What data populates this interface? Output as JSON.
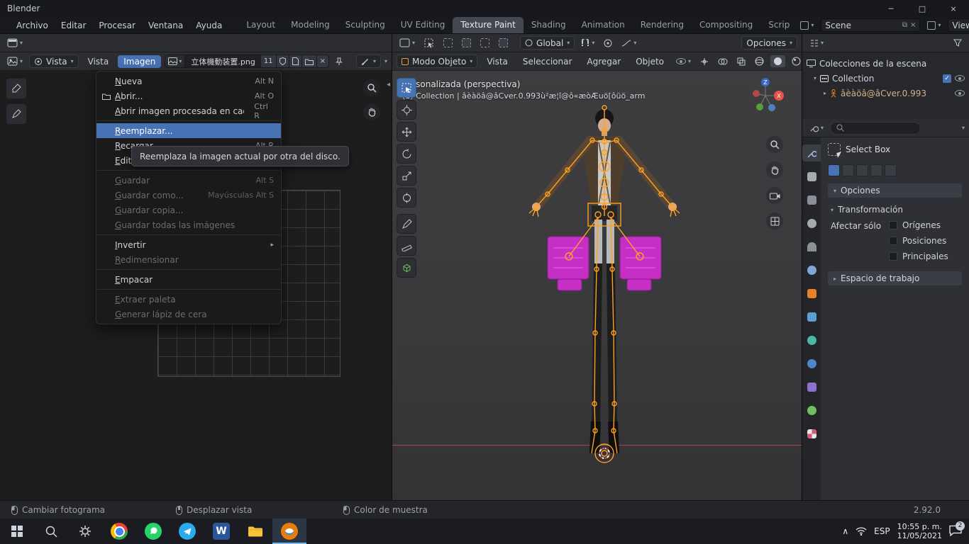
{
  "icons": {
    "chevron_down": "▾",
    "chevron_right": "▸",
    "chevron_left": "◂",
    "tray_chevron": "∧",
    "close": "×",
    "minimize": "─",
    "maximize": "□",
    "check": "✓"
  },
  "colors": {
    "accent_blue": "#4772b3",
    "blender_orange": "#e87d0d",
    "armature_orange": "#ffa021",
    "gear_magenta": "#c62fc6"
  },
  "titlebar": {
    "title": "Blender"
  },
  "topbar": {
    "menus": [
      {
        "label": "Archivo"
      },
      {
        "label": "Editar"
      },
      {
        "label": "Procesar"
      },
      {
        "label": "Ventana"
      },
      {
        "label": "Ayuda"
      }
    ],
    "workspaces": [
      {
        "label": "Layout"
      },
      {
        "label": "Modeling"
      },
      {
        "label": "Sculpting"
      },
      {
        "label": "UV Editing"
      },
      {
        "label": "Texture Paint"
      },
      {
        "label": "Shading"
      },
      {
        "label": "Animation"
      },
      {
        "label": "Rendering"
      },
      {
        "label": "Compositing"
      },
      {
        "label": "Scrip"
      }
    ],
    "scene": {
      "value": "Scene"
    },
    "view_layer": {
      "value": "View Layer"
    }
  },
  "image_editor": {
    "mode": "Vista",
    "view_menu": "Vista",
    "image_menu": "Imagen",
    "image": {
      "name": "立体機動装置.png",
      "users": "11"
    },
    "menu": {
      "items": [
        {
          "label": "Nueva",
          "shortcut": "Alt N"
        },
        {
          "label": "Abrir...",
          "shortcut": "Alt O"
        },
        {
          "label": "Abrir imagen procesada en caché",
          "shortcut": "Ctrl R"
        },
        {
          "label": "Reemplazar...",
          "shortcut": ""
        },
        {
          "label": "Recargar",
          "shortcut": "Alt R"
        },
        {
          "label": "Editar e",
          "shortcut": ""
        },
        {
          "label": "Guardar",
          "shortcut": "Alt S"
        },
        {
          "label": "Guardar como...",
          "shortcut": "Mayúsculas Alt S"
        },
        {
          "label": "Guardar copia...",
          "shortcut": ""
        },
        {
          "label": "Guardar todas las imágenes",
          "shortcut": ""
        },
        {
          "label": "Invertir",
          "shortcut": ""
        },
        {
          "label": "Redimensionar",
          "shortcut": ""
        },
        {
          "label": "Empacar",
          "shortcut": ""
        },
        {
          "label": "Extraer paleta",
          "shortcut": ""
        },
        {
          "label": "Generar lápiz de cera",
          "shortcut": ""
        }
      ]
    },
    "tooltip": "Reemplaza la imagen actual por otra del disco."
  },
  "viewport": {
    "header": {
      "mode": "Modo Objeto",
      "menus": [
        {
          "label": "Vista"
        },
        {
          "label": "Seleccionar"
        },
        {
          "label": "Agregar"
        },
        {
          "label": "Objeto"
        }
      ],
      "orientation": "Global",
      "options": "Opciones"
    },
    "overlay": {
      "line1": "Personalizada (perspectiva)",
      "line2": "(1) Collection | âèàöâ@âCver.0.993ù²æ¦î@ô«æòÆuö[ôüö_arm"
    },
    "gizmo": {
      "x": "X",
      "z": "Z"
    }
  },
  "outliner": {
    "items": [
      {
        "label": "Colecciones de la escena"
      },
      {
        "label": "Collection"
      },
      {
        "label": "âèàöâ@âCver.0.993"
      }
    ]
  },
  "tool_panel": {
    "tool_name": "Select Box",
    "sections": {
      "options": "Opciones",
      "transform": "Transformación",
      "workspace": "Espacio de trabajo"
    },
    "affect_label": "Afectar sólo",
    "checkboxes": [
      {
        "label": "Orígenes"
      },
      {
        "label": "Posiciones"
      },
      {
        "label": "Principales"
      }
    ]
  },
  "statusbar": {
    "hints": [
      {
        "label": "Cambiar fotograma"
      },
      {
        "label": "Desplazar vista"
      },
      {
        "label": "Color de muestra"
      }
    ],
    "version": "2.92.0"
  },
  "taskbar": {
    "tray": {
      "lang": "ESP",
      "time": "10:55 p. m.",
      "date": "11/05/2021",
      "badge": "2"
    }
  }
}
